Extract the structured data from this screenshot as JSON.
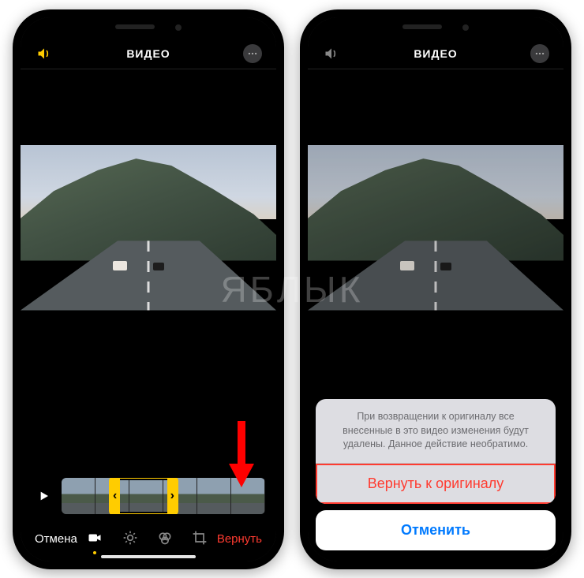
{
  "watermark": "ЯБЛЫК",
  "header": {
    "title": "ВИДЕО"
  },
  "left": {
    "bottom": {
      "cancel": "Отмена",
      "revert": "Вернуть"
    }
  },
  "right": {
    "sheet": {
      "message": "При возвращении к оригиналу все внесенные в это видео изменения будут удалены. Данное действие необратимо.",
      "revert": "Вернуть к оригиналу",
      "cancel": "Отменить"
    }
  }
}
